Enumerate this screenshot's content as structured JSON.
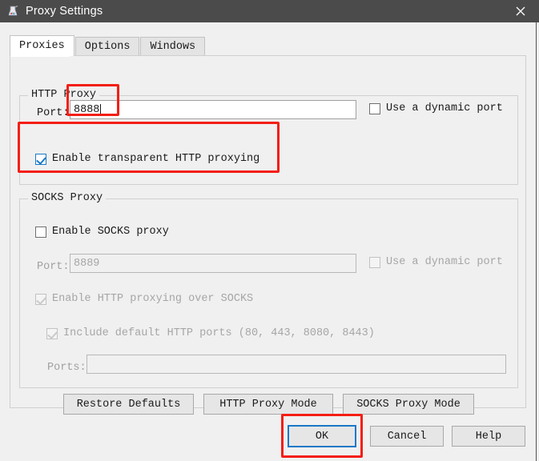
{
  "window": {
    "title": "Proxy Settings",
    "icon": "app-icon",
    "close_label": "✕",
    "titlebar_color": "#4b4b4b"
  },
  "tabs": [
    {
      "label": "Proxies",
      "selected": true
    },
    {
      "label": "Options",
      "selected": false
    },
    {
      "label": "Windows",
      "selected": false
    }
  ],
  "http_group": {
    "title": "HTTP Proxy",
    "port_label": "Port:",
    "port_value": "8888",
    "dynamic_port_label": "Use a dynamic port",
    "dynamic_port_checked": false,
    "transparent_label": "Enable transparent HTTP proxying",
    "transparent_checked": true
  },
  "socks_group": {
    "title": "SOCKS Proxy",
    "enable_label": "Enable SOCKS proxy",
    "enable_checked": false,
    "port_label": "Port:",
    "port_value": "8889",
    "dynamic_port_label": "Use a dynamic port",
    "http_over_socks_label": "Enable HTTP proxying over SOCKS",
    "http_over_socks_checked": true,
    "default_ports_label": "Include default HTTP ports (80, 443, 8080, 8443)",
    "default_ports_checked": true,
    "ports_label": "Ports:",
    "ports_value": ""
  },
  "mode_buttons": {
    "restore": "Restore Defaults",
    "http_mode": "HTTP Proxy Mode",
    "socks_mode": "SOCKS Proxy Mode"
  },
  "dialog_buttons": {
    "ok": "OK",
    "cancel": "Cancel",
    "help": "Help"
  },
  "annotations": {
    "color": "#f41e14",
    "regions": [
      "http-port-field",
      "transparent-proxying-checkbox",
      "ok-button"
    ]
  }
}
